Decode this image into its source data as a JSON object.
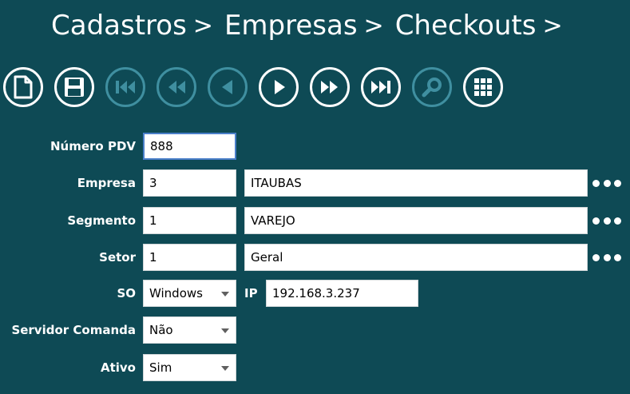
{
  "breadcrumb": {
    "items": [
      "Cadastros",
      "Empresas",
      "Checkouts"
    ],
    "separator": ">"
  },
  "toolbar": {
    "buttons": [
      {
        "name": "new-document-icon",
        "enabled": true
      },
      {
        "name": "save-icon",
        "enabled": true
      },
      {
        "name": "first-record-icon",
        "enabled": false
      },
      {
        "name": "rewind-icon",
        "enabled": false
      },
      {
        "name": "previous-record-icon",
        "enabled": false
      },
      {
        "name": "next-record-icon",
        "enabled": true
      },
      {
        "name": "fast-forward-icon",
        "enabled": true
      },
      {
        "name": "last-record-icon",
        "enabled": true
      },
      {
        "name": "search-icon",
        "enabled": false
      },
      {
        "name": "grid-icon",
        "enabled": true
      }
    ]
  },
  "form": {
    "numero_pdv": {
      "label": "Número PDV",
      "value": "888"
    },
    "empresa": {
      "label": "Empresa",
      "code": "3",
      "name": "ITAUBAS"
    },
    "segmento": {
      "label": "Segmento",
      "code": "1",
      "name": "VAREJO"
    },
    "setor": {
      "label": "Setor",
      "code": "1",
      "name": "Geral"
    },
    "so": {
      "label": "SO",
      "value": "Windows"
    },
    "ip": {
      "label": "IP",
      "value": "192.168.3.237"
    },
    "servidor_comanda": {
      "label": "Servidor Comanda",
      "value": "Não"
    },
    "ativo": {
      "label": "Ativo",
      "value": "Sim"
    }
  },
  "colors": {
    "background": "#0e4a55",
    "disabled_icon": "#3f8fa0",
    "focus_border": "#4a7fc9"
  }
}
